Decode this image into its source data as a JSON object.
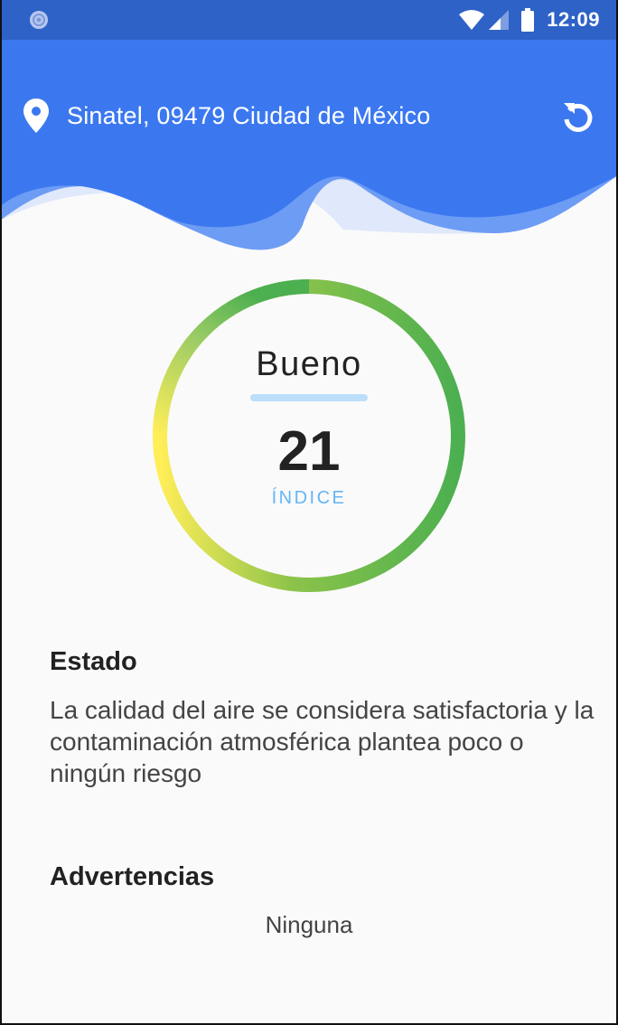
{
  "status_bar": {
    "time": "12:09",
    "icons": [
      "notification-icon",
      "wifi-icon",
      "signal-icon",
      "battery-icon"
    ]
  },
  "header": {
    "location": "Sinatel, 09479 Ciudad de México",
    "icons": [
      "location-pin-icon",
      "refresh-icon"
    ]
  },
  "gauge": {
    "status": "Bueno",
    "index_value": "21",
    "index_label": "ÍNDICE"
  },
  "state": {
    "title": "Estado",
    "text": "La calidad del aire se considera satisfactoria y la contaminación atmosférica plantea poco o ningún riesgo"
  },
  "warnings": {
    "title": "Advertencias",
    "text": "Ninguna"
  },
  "colors": {
    "header_blue": "#3b78f0",
    "statusbar_blue": "#2f62c6",
    "gauge_green": "#4caf50",
    "gauge_yellow": "#ffee58",
    "index_label": "#64b5f6"
  }
}
